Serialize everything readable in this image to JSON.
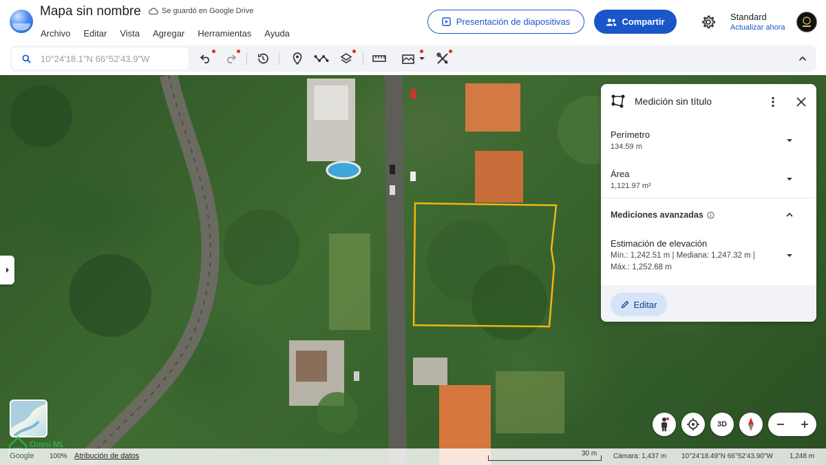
{
  "header": {
    "title": "Mapa sin nombre",
    "saved_status": "Se guardó en Google Drive",
    "menu": [
      "Archivo",
      "Editar",
      "Vista",
      "Agregar",
      "Herramientas",
      "Ayuda"
    ],
    "present_label": "Presentación de diapositivas",
    "share_label": "Compartir",
    "style_name": "Standard",
    "update_label": "Actualizar ahora"
  },
  "search": {
    "placeholder": "10°24'18.1\"N 66°52'43.9\"W"
  },
  "panel": {
    "title": "Medición sin título",
    "perimeter_label": "Perímetro",
    "perimeter_value": "134.59 m",
    "area_label": "Área",
    "area_value": "1,121.97 m²",
    "advanced_label": "Mediciones avanzadas",
    "elevation_label": "Estimación de elevación",
    "elevation_line1": "Mín.: 1,242.51 m | Mediana: 1,247.32 m |",
    "elevation_line2": "Máx.: 1,252.68 m",
    "edit_label": "Editar"
  },
  "controls": {
    "three_d_label": "3D"
  },
  "bottom": {
    "google": "Google",
    "zoom": "100%",
    "attribution": "Atribución de datos",
    "scale": "30 m",
    "camera": "Cámara: 1,437 m",
    "coords": "10°24'18.49\"N 66°52'43.90\"W",
    "elevation": "1,248 m"
  },
  "watermark": "Omni MLS",
  "colors": {
    "accent": "#1a56c9",
    "measurement_outline": "#f5b416",
    "notification_dot": "#d93025"
  }
}
